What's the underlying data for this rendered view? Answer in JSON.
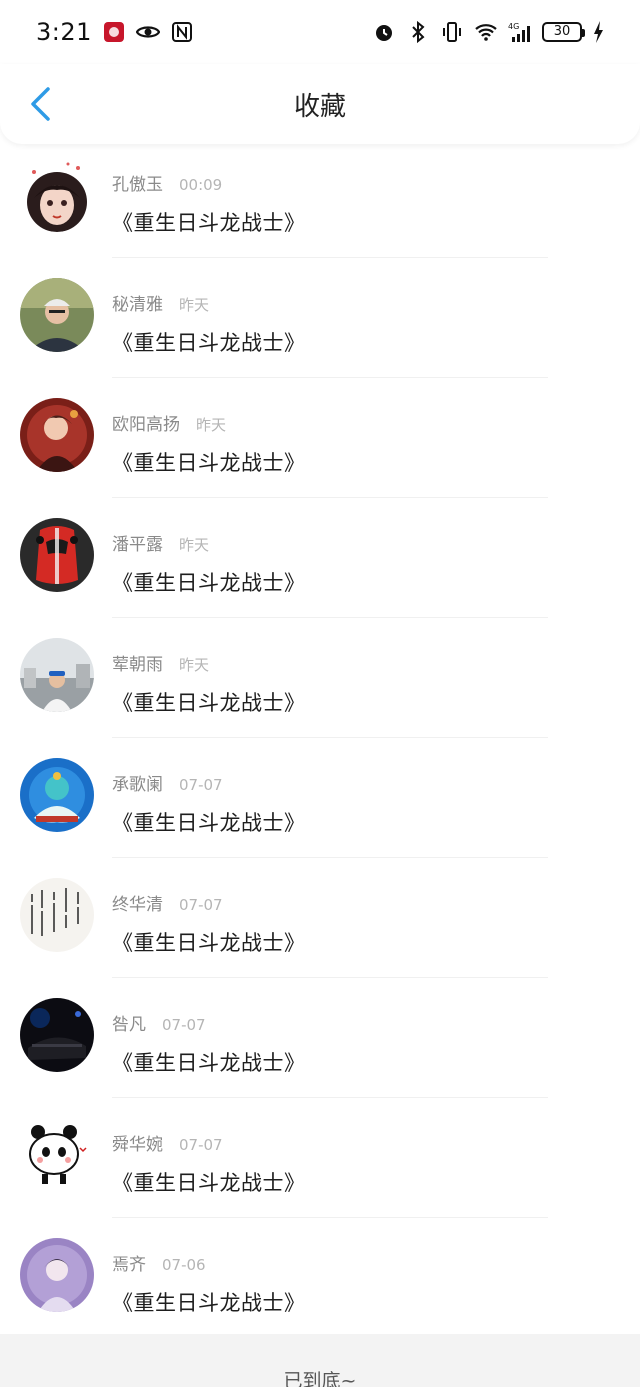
{
  "status_bar": {
    "time": "3:21",
    "battery": "30",
    "left_icons": [
      "app-badge-icon",
      "eye-icon",
      "nfc-icon"
    ],
    "right_icons": [
      "alarm-icon",
      "bluetooth-icon",
      "vibrate-icon",
      "wifi-icon",
      "4g-signal-icon",
      "battery-icon",
      "charging-icon"
    ]
  },
  "header": {
    "title": "收藏",
    "back_icon": "chevron-left-icon",
    "accent_color": "#2e9be6"
  },
  "items": [
    {
      "name": "孔傲玉",
      "time": "00:09",
      "title": "《重生日斗龙战士》",
      "avatar": "anime-girl-avatar"
    },
    {
      "name": "秘清雅",
      "time": "昨天",
      "title": "《重生日斗龙战士》",
      "avatar": "man-cap-avatar"
    },
    {
      "name": "欧阳高扬",
      "time": "昨天",
      "title": "《重生日斗龙战士》",
      "avatar": "anime-red-avatar"
    },
    {
      "name": "潘平露",
      "time": "昨天",
      "title": "《重生日斗龙战士》",
      "avatar": "red-car-avatar"
    },
    {
      "name": "荤朝雨",
      "time": "昨天",
      "title": "《重生日斗龙战士》",
      "avatar": "person-street-avatar"
    },
    {
      "name": "承歌阑",
      "time": "07-07",
      "title": "《重生日斗龙战士》",
      "avatar": "deity-blue-avatar"
    },
    {
      "name": "终华清",
      "time": "07-07",
      "title": "《重生日斗龙战士》",
      "avatar": "calligraphy-avatar"
    },
    {
      "name": "咎凡",
      "time": "07-07",
      "title": "《重生日斗龙战士》",
      "avatar": "dark-car-avatar"
    },
    {
      "name": "舜华婉",
      "time": "07-07",
      "title": "《重生日斗龙战士》",
      "avatar": "panda-avatar"
    },
    {
      "name": "焉齐",
      "time": "07-06",
      "title": "《重生日斗龙战士》",
      "avatar": "purple-girl-avatar"
    }
  ],
  "footer": {
    "text": "已到底~"
  }
}
